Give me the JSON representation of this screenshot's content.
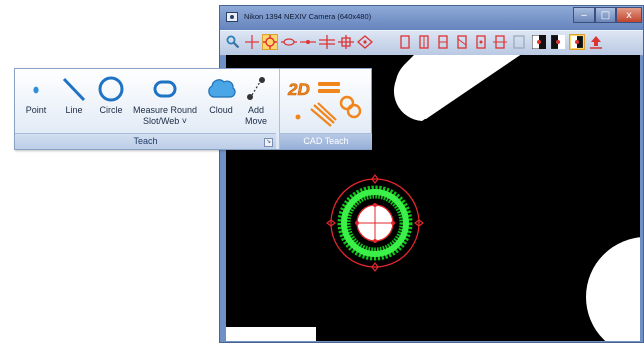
{
  "camera_window": {
    "title": "Nikon 1394 NEXIV Camera (640x480)",
    "controls": {
      "minimize": "‒",
      "maximize": "□",
      "close": "x"
    }
  },
  "ribbon": {
    "teach_group": {
      "title": "Teach",
      "buttons": [
        {
          "label": "Point",
          "icon": "point-icon"
        },
        {
          "label": "Line",
          "icon": "line-icon"
        },
        {
          "label": "Circle",
          "icon": "circle-icon"
        },
        {
          "label": "Measure Round",
          "label2": "Slot/Web ˅",
          "icon": "round-slot-icon"
        },
        {
          "label": "Cloud",
          "icon": "cloud-icon"
        },
        {
          "label": "Add",
          "label2": "Move",
          "icon": "add-move-icon"
        }
      ]
    },
    "cad_group": {
      "title": "CAD Teach"
    }
  }
}
